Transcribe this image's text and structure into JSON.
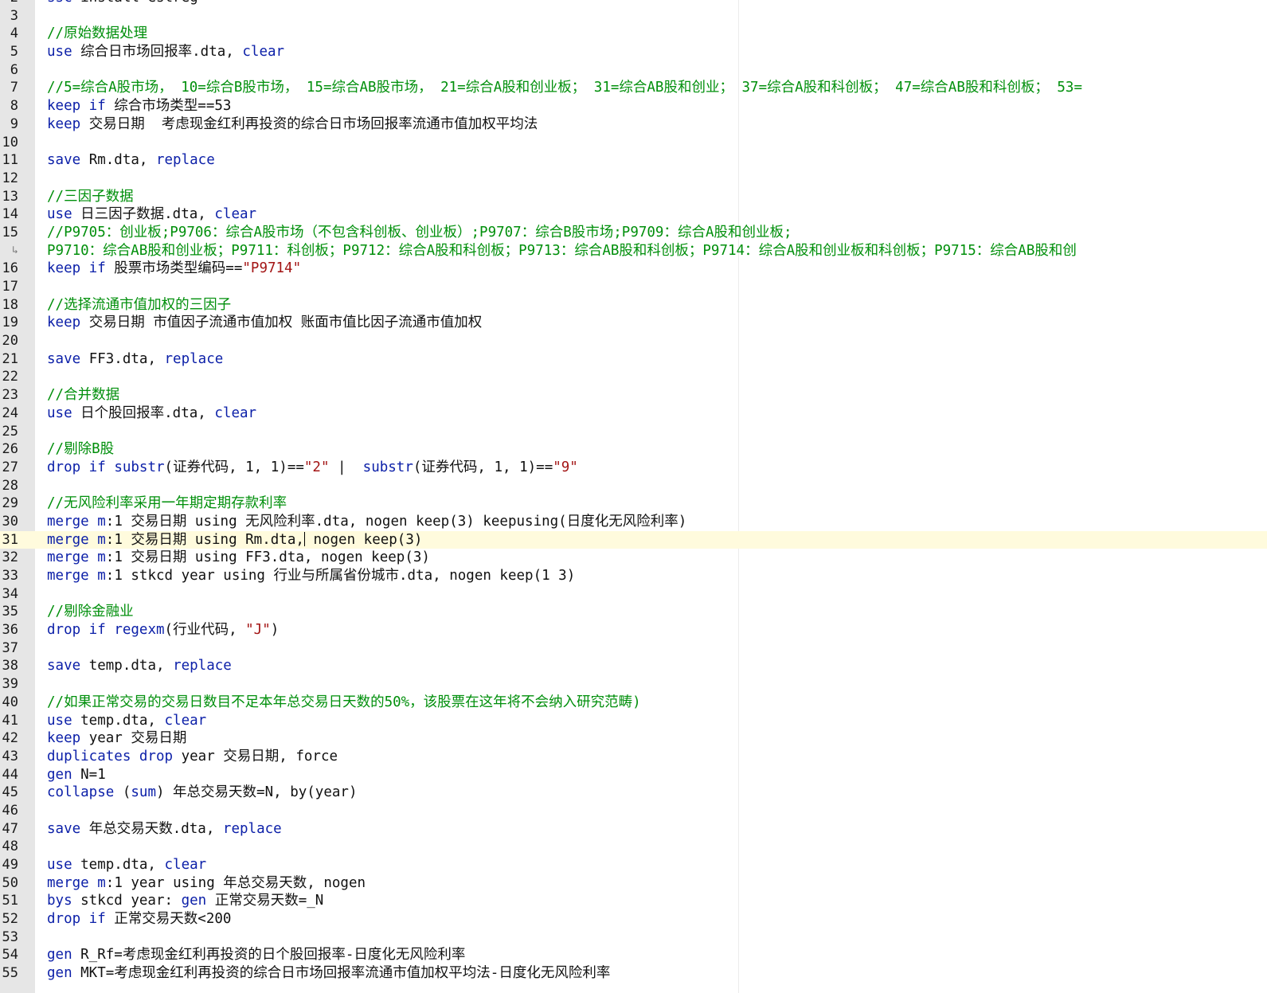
{
  "editor": {
    "colors": {
      "keyword": "#0b1fa8",
      "comment": "#008f0b",
      "string": "#a31515",
      "text": "#111111",
      "gutter": "#e6e6e6",
      "current_line": "#fffbdd"
    },
    "current_line": "31",
    "lines": [
      {
        "num": "2",
        "tokens": [
          [
            "kw",
            "ssc"
          ],
          [
            "tx",
            " install"
          ],
          [
            "tx",
            " estreg"
          ]
        ]
      },
      {
        "num": "3",
        "tokens": []
      },
      {
        "num": "4",
        "tokens": [
          [
            "cm",
            "//原始数据处理"
          ]
        ]
      },
      {
        "num": "5",
        "tokens": [
          [
            "kw",
            "use"
          ],
          [
            "tx",
            " 综合日市场回报率.dta, "
          ],
          [
            "kw",
            "clear"
          ]
        ]
      },
      {
        "num": "6",
        "tokens": []
      },
      {
        "num": "7",
        "tokens": [
          [
            "cm",
            "//5=综合A股市场， 10=综合B股市场， 15=综合AB股市场， 21=综合A股和创业板； 31=综合AB股和创业； 37=综合A股和科创板； 47=综合AB股和科创板； 53="
          ]
        ]
      },
      {
        "num": "8",
        "tokens": [
          [
            "kw",
            "keep if"
          ],
          [
            "tx",
            " 综合市场类型==53"
          ]
        ]
      },
      {
        "num": "9",
        "tokens": [
          [
            "kw",
            "keep"
          ],
          [
            "tx",
            " 交易日期  考虑现金红利再投资的综合日市场回报率流通市值加权平均法"
          ]
        ]
      },
      {
        "num": "10",
        "tokens": []
      },
      {
        "num": "11",
        "tokens": [
          [
            "kw",
            "save"
          ],
          [
            "tx",
            " Rm.dta, "
          ],
          [
            "kw",
            "replace"
          ]
        ]
      },
      {
        "num": "12",
        "tokens": []
      },
      {
        "num": "13",
        "tokens": [
          [
            "cm",
            "//三因子数据"
          ]
        ]
      },
      {
        "num": "14",
        "tokens": [
          [
            "kw",
            "use"
          ],
          [
            "tx",
            " 日三因子数据.dta, "
          ],
          [
            "kw",
            "clear"
          ]
        ]
      },
      {
        "num": "15",
        "tokens": [
          [
            "cm",
            "//P9705：创业板;P9706：综合A股市场（不包含科创板、创业板）;P9707：综合B股市场;P9709：综合A股和创业板;"
          ]
        ]
      },
      {
        "num": "↳",
        "fold": true,
        "tokens": [
          [
            "cm",
            "P9710：综合AB股和创业板；P9711：科创板；P9712：综合A股和科创板；P9713：综合AB股和科创板；P9714：综合A股和创业板和科创板；P9715：综合AB股和创"
          ]
        ]
      },
      {
        "num": "16",
        "tokens": [
          [
            "kw",
            "keep if"
          ],
          [
            "tx",
            " 股票市场类型编码=="
          ],
          [
            "st",
            "\"P9714\""
          ]
        ]
      },
      {
        "num": "17",
        "tokens": []
      },
      {
        "num": "18",
        "tokens": [
          [
            "cm",
            "//选择流通市值加权的三因子"
          ]
        ]
      },
      {
        "num": "19",
        "tokens": [
          [
            "kw",
            "keep"
          ],
          [
            "tx",
            " 交易日期 市值因子流通市值加权 账面市值比因子流通市值加权"
          ]
        ]
      },
      {
        "num": "20",
        "tokens": []
      },
      {
        "num": "21",
        "tokens": [
          [
            "kw",
            "save"
          ],
          [
            "tx",
            " FF3.dta, "
          ],
          [
            "kw",
            "replace"
          ]
        ]
      },
      {
        "num": "22",
        "tokens": []
      },
      {
        "num": "23",
        "tokens": [
          [
            "cm",
            "//合并数据"
          ]
        ]
      },
      {
        "num": "24",
        "tokens": [
          [
            "kw",
            "use"
          ],
          [
            "tx",
            " 日个股回报率.dta, "
          ],
          [
            "kw",
            "clear"
          ]
        ]
      },
      {
        "num": "25",
        "tokens": []
      },
      {
        "num": "26",
        "tokens": [
          [
            "cm",
            "//剔除B股"
          ]
        ]
      },
      {
        "num": "27",
        "tokens": [
          [
            "kw",
            "drop if"
          ],
          [
            "tx",
            " "
          ],
          [
            "kw",
            "substr"
          ],
          [
            "tx",
            "(证券代码, 1, 1)=="
          ],
          [
            "st",
            "\"2\""
          ],
          [
            "tx",
            " |  "
          ],
          [
            "kw",
            "substr"
          ],
          [
            "tx",
            "(证券代码, 1, 1)=="
          ],
          [
            "st",
            "\"9\""
          ]
        ]
      },
      {
        "num": "28",
        "tokens": []
      },
      {
        "num": "29",
        "tokens": [
          [
            "cm",
            "//无风险利率采用一年期定期存款利率"
          ]
        ]
      },
      {
        "num": "30",
        "tokens": [
          [
            "kw",
            "merge"
          ],
          [
            "tx",
            " "
          ],
          [
            "kw",
            "m"
          ],
          [
            "tx",
            ":1 交易日期 using 无风险利率.dta, nogen keep(3) keepusing(日度化无风险利率)"
          ]
        ]
      },
      {
        "num": "31",
        "tokens": [
          [
            "kw",
            "merge"
          ],
          [
            "tx",
            " "
          ],
          [
            "kw",
            "m"
          ],
          [
            "tx",
            ":1 交易日期 using Rm.dta,"
          ],
          [
            "caret",
            ""
          ],
          [
            "tx",
            " nogen keep(3)"
          ]
        ]
      },
      {
        "num": "32",
        "tokens": [
          [
            "kw",
            "merge"
          ],
          [
            "tx",
            " "
          ],
          [
            "kw",
            "m"
          ],
          [
            "tx",
            ":1 交易日期 using FF3.dta, nogen keep(3)"
          ]
        ]
      },
      {
        "num": "33",
        "tokens": [
          [
            "kw",
            "merge"
          ],
          [
            "tx",
            " "
          ],
          [
            "kw",
            "m"
          ],
          [
            "tx",
            ":1 stkcd year using 行业与所属省份城市.dta, nogen keep(1 3)"
          ]
        ]
      },
      {
        "num": "34",
        "tokens": []
      },
      {
        "num": "35",
        "tokens": [
          [
            "cm",
            "//剔除金融业"
          ]
        ]
      },
      {
        "num": "36",
        "tokens": [
          [
            "kw",
            "drop if"
          ],
          [
            "tx",
            " "
          ],
          [
            "kw",
            "regexm"
          ],
          [
            "tx",
            "(行业代码, "
          ],
          [
            "st",
            "\"J\""
          ],
          [
            "tx",
            ")"
          ]
        ]
      },
      {
        "num": "37",
        "tokens": []
      },
      {
        "num": "38",
        "tokens": [
          [
            "kw",
            "save"
          ],
          [
            "tx",
            " temp.dta, "
          ],
          [
            "kw",
            "replace"
          ]
        ]
      },
      {
        "num": "39",
        "tokens": []
      },
      {
        "num": "40",
        "tokens": [
          [
            "cm",
            "//如果正常交易的交易日数目不足本年总交易日天数的50%，该股票在这年将不会纳入研究范畴)"
          ]
        ]
      },
      {
        "num": "41",
        "tokens": [
          [
            "kw",
            "use"
          ],
          [
            "tx",
            " temp.dta, "
          ],
          [
            "kw",
            "clear"
          ]
        ]
      },
      {
        "num": "42",
        "tokens": [
          [
            "kw",
            "keep"
          ],
          [
            "tx",
            " year 交易日期"
          ]
        ]
      },
      {
        "num": "43",
        "tokens": [
          [
            "kw",
            "duplicates drop"
          ],
          [
            "tx",
            " year 交易日期, force"
          ]
        ]
      },
      {
        "num": "44",
        "tokens": [
          [
            "kw",
            "gen"
          ],
          [
            "tx",
            " N=1"
          ]
        ]
      },
      {
        "num": "45",
        "tokens": [
          [
            "kw",
            "collapse"
          ],
          [
            "tx",
            " ("
          ],
          [
            "kw",
            "sum"
          ],
          [
            "tx",
            ") 年总交易天数=N, by(year)"
          ]
        ]
      },
      {
        "num": "46",
        "tokens": []
      },
      {
        "num": "47",
        "tokens": [
          [
            "kw",
            "save"
          ],
          [
            "tx",
            " 年总交易天数.dta, "
          ],
          [
            "kw",
            "replace"
          ]
        ]
      },
      {
        "num": "48",
        "tokens": []
      },
      {
        "num": "49",
        "tokens": [
          [
            "kw",
            "use"
          ],
          [
            "tx",
            " temp.dta, "
          ],
          [
            "kw",
            "clear"
          ]
        ]
      },
      {
        "num": "50",
        "tokens": [
          [
            "kw",
            "merge"
          ],
          [
            "tx",
            " "
          ],
          [
            "kw",
            "m"
          ],
          [
            "tx",
            ":1 year using 年总交易天数, nogen"
          ]
        ]
      },
      {
        "num": "51",
        "tokens": [
          [
            "kw",
            "bys"
          ],
          [
            "tx",
            " stkcd year: "
          ],
          [
            "kw",
            "gen"
          ],
          [
            "tx",
            " 正常交易天数=_N"
          ]
        ]
      },
      {
        "num": "52",
        "tokens": [
          [
            "kw",
            "drop if"
          ],
          [
            "tx",
            " 正常交易天数<200"
          ]
        ]
      },
      {
        "num": "53",
        "tokens": []
      },
      {
        "num": "54",
        "tokens": [
          [
            "kw",
            "gen"
          ],
          [
            "tx",
            " R_Rf=考虑现金红利再投资的日个股回报率-日度化无风险利率"
          ]
        ]
      },
      {
        "num": "55",
        "tokens": [
          [
            "kw",
            "gen"
          ],
          [
            "tx",
            " MKT=考虑现金红利再投资的综合日市场回报率流通市值加权平均法-日度化无风险利率"
          ]
        ]
      }
    ]
  }
}
